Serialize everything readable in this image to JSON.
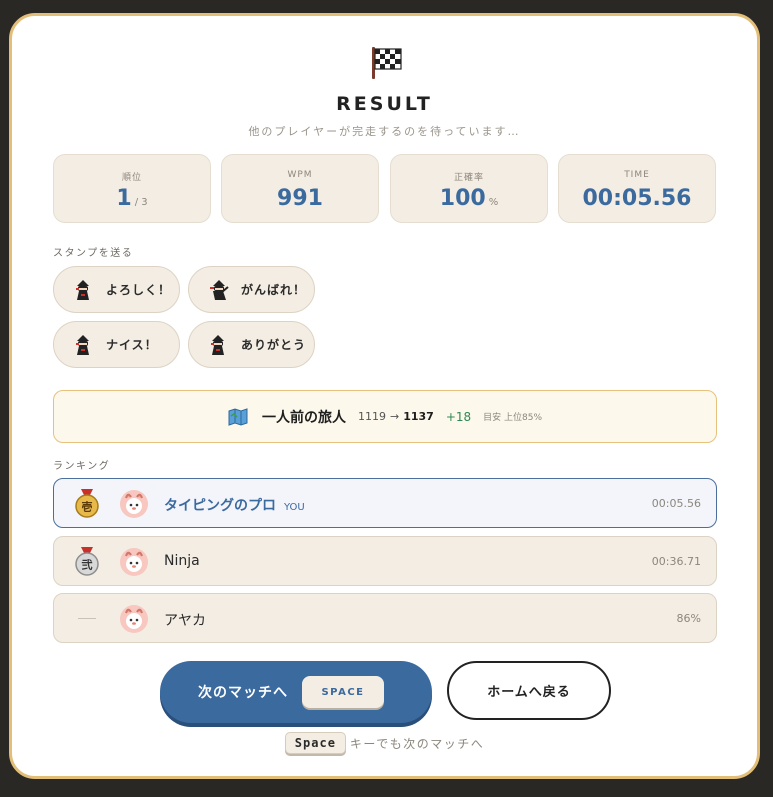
{
  "header": {
    "title": "RESULT",
    "subtitle": "他のプレイヤーが完走するのを待っています…",
    "icon": "checkered-flag-icon"
  },
  "stats": [
    {
      "label": "順位",
      "value": "1",
      "suffix": "/ 3"
    },
    {
      "label": "WPM",
      "value": "991",
      "suffix": ""
    },
    {
      "label": "正確率",
      "value": "100",
      "suffix": "%"
    },
    {
      "label": "TIME",
      "value": "00:05.56",
      "suffix": ""
    }
  ],
  "stamps": {
    "label": "スタンプを送る",
    "items": [
      {
        "label": "よろしく！",
        "icon": "ninja-icon"
      },
      {
        "label": "がんばれ！",
        "icon": "ninja-icon"
      },
      {
        "label": "ナイス！",
        "icon": "ninja-icon"
      },
      {
        "label": "ありがとう",
        "icon": "ninja-icon"
      }
    ]
  },
  "rank_progress": {
    "icon": "map-icon",
    "title": "一人前の旅人",
    "from": "1119",
    "arrow": "→",
    "to": "1137",
    "delta": "+18",
    "note": "目安 上位85%"
  },
  "ranking": {
    "label": "ランキング",
    "rows": [
      {
        "medal": "壱",
        "name": "タイピングのプロ",
        "you": "YOU",
        "value": "00:05.56",
        "is_me": true
      },
      {
        "medal": "弐",
        "name": "Ninja",
        "you": "",
        "value": "00:36.71",
        "is_me": false
      },
      {
        "medal": "",
        "name": "アヤカ",
        "you": "",
        "value": "86%",
        "is_me": false
      }
    ]
  },
  "actions": {
    "next_label": "次のマッチへ",
    "next_key": "SPACE",
    "home_label": "ホームへ戻る",
    "hint_key": "Space",
    "hint_text": "キーでも次のマッチへ"
  },
  "colors": {
    "accent": "#3b6a9f",
    "card_border": "#e2be78",
    "chip_bg": "#f4ede3",
    "delta_green": "#2f8a55"
  }
}
